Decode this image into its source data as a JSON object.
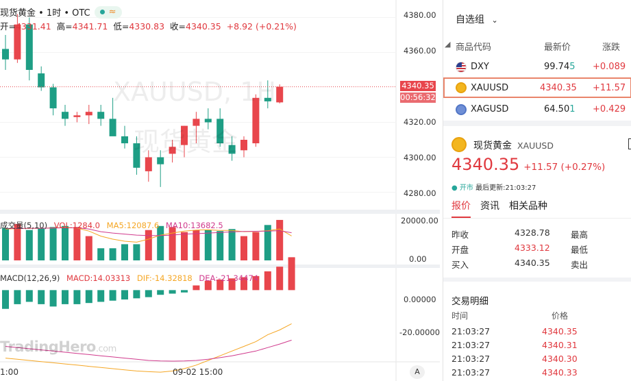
{
  "header": {
    "title": "现货黄金 • 1时 • OTC",
    "status_wave": "≈"
  },
  "ohlc": {
    "open_label": "开=",
    "open": "4331.41",
    "high_label": "高=",
    "high": "4341.71",
    "low_label": "低=",
    "low": "4330.83",
    "close_label": "收=",
    "close": "4340.35",
    "change": "+8.92 (+0.21%)"
  },
  "watermark": {
    "symbol": "XAUUSD, 1H",
    "name": "现货黄金"
  },
  "brand": {
    "name": "TradingHero",
    "suffix": ".com"
  },
  "price_axis": [
    "4380.00",
    "4360.00",
    "4340.35",
    "4320.00",
    "4300.00",
    "4280.00"
  ],
  "current_price_tag": {
    "price": "4340.35",
    "countdown": "00:56:32"
  },
  "volume_legend": {
    "label": "成交量(5,10)",
    "vol": "VOL:1284.0",
    "ma5": "MA5:12087.6",
    "ma10": "MA10:13682.5"
  },
  "volume_axis": [
    "20000.00",
    "0.00"
  ],
  "macd_legend": {
    "label": "MACD(12,26,9)",
    "macd": "MACD:14.03313",
    "dif": "DIF:-14.32818",
    "dea": "DEA:-21.34474"
  },
  "macd_axis": [
    "0.00000",
    "-20.00000"
  ],
  "time_axis": [
    "1:00",
    "09-02 15:00"
  ],
  "auto_button": "A",
  "chart_data": {
    "type": "candlestick",
    "ylim": [
      4270,
      4390
    ],
    "candles": [
      {
        "o": 4362,
        "h": 4370,
        "l": 4350,
        "c": 4356
      },
      {
        "o": 4356,
        "h": 4382,
        "l": 4354,
        "c": 4376
      },
      {
        "o": 4376,
        "h": 4380,
        "l": 4344,
        "c": 4350
      },
      {
        "o": 4348,
        "h": 4352,
        "l": 4338,
        "c": 4340
      },
      {
        "o": 4340,
        "h": 4342,
        "l": 4324,
        "c": 4328
      },
      {
        "o": 4326,
        "h": 4330,
        "l": 4318,
        "c": 4322
      },
      {
        "o": 4323,
        "h": 4326,
        "l": 4320,
        "c": 4324
      },
      {
        "o": 4324,
        "h": 4330,
        "l": 4319,
        "c": 4326
      },
      {
        "o": 4326,
        "h": 4330,
        "l": 4318,
        "c": 4322
      },
      {
        "o": 4322,
        "h": 4334,
        "l": 4316,
        "c": 4312
      },
      {
        "o": 4312,
        "h": 4318,
        "l": 4305,
        "c": 4308
      },
      {
        "o": 4308,
        "h": 4312,
        "l": 4290,
        "c": 4294
      },
      {
        "o": 4292,
        "h": 4304,
        "l": 4286,
        "c": 4300
      },
      {
        "o": 4300,
        "h": 4304,
        "l": 4283,
        "c": 4296
      },
      {
        "o": 4302,
        "h": 4310,
        "l": 4297,
        "c": 4306
      },
      {
        "o": 4307,
        "h": 4318,
        "l": 4300,
        "c": 4318
      },
      {
        "o": 4318,
        "h": 4326,
        "l": 4308,
        "c": 4322
      },
      {
        "o": 4322,
        "h": 4328,
        "l": 4316,
        "c": 4320
      },
      {
        "o": 4322,
        "h": 4328,
        "l": 4306,
        "c": 4308
      },
      {
        "o": 4307,
        "h": 4312,
        "l": 4298,
        "c": 4302
      },
      {
        "o": 4304,
        "h": 4312,
        "l": 4300,
        "c": 4310
      },
      {
        "o": 4308,
        "h": 4336,
        "l": 4306,
        "c": 4334
      },
      {
        "o": 4334,
        "h": 4344,
        "l": 4328,
        "c": 4332
      },
      {
        "o": 4331.41,
        "h": 4341.71,
        "l": 4330.83,
        "c": 4340.35
      }
    ],
    "volume": {
      "ylim": [
        0,
        21000
      ],
      "values": [
        16000,
        18000,
        15000,
        16000,
        16500,
        17000,
        16500,
        12000,
        6000,
        6000,
        8000,
        8000,
        15000,
        17000,
        16500,
        14000,
        15000,
        15000,
        14500,
        15500,
        12000,
        14000,
        17500,
        20000,
        1284
      ],
      "ma5": [
        15500,
        15700,
        15800,
        15900,
        16100,
        16300,
        16000,
        14500,
        12000,
        10500,
        9500,
        9000,
        10500,
        12500,
        13500,
        14500,
        15000,
        15100,
        14800,
        14800,
        14200,
        14300,
        14700,
        15500,
        12087.6
      ],
      "ma10": [
        15800,
        15800,
        15900,
        15900,
        16000,
        16100,
        16100,
        15500,
        14200,
        13500,
        13000,
        12500,
        12300,
        12300,
        12500,
        13000,
        13200,
        13500,
        13800,
        14100,
        14300,
        14400,
        14500,
        14700,
        13682.5
      ]
    },
    "macd": {
      "ylim": [
        -30,
        8
      ],
      "hist": [
        -8,
        -6,
        -5,
        -6,
        -7,
        -6,
        -6,
        -5.5,
        -5,
        -4.5,
        -4,
        -3.5,
        -3,
        -2,
        -1.5,
        -1,
        2,
        4,
        4.5,
        5,
        5.5,
        6,
        8,
        10,
        14.03
      ],
      "dif": [
        -29,
        -29.5,
        -30,
        -30.5,
        -31,
        -31.5,
        -32,
        -32.5,
        -33,
        -33.5,
        -34,
        -34.5,
        -34.8,
        -35,
        -34.5,
        -33.5,
        -32,
        -30,
        -28,
        -26,
        -24,
        -22,
        -19,
        -17,
        -14.33
      ],
      "dea": [
        -24,
        -24.5,
        -25,
        -25.5,
        -26,
        -26.5,
        -27,
        -27.5,
        -28,
        -28.5,
        -29,
        -29.5,
        -30,
        -30.2,
        -30.3,
        -30.2,
        -30,
        -29.5,
        -28.8,
        -28,
        -27,
        -26,
        -24.5,
        -23,
        -21.34
      ]
    }
  },
  "panel": {
    "watchlist_title": "自选组",
    "columns": {
      "symbol": "商品代码",
      "last": "最新价",
      "change": "涨跌"
    },
    "rows": [
      {
        "symbol": "DXY",
        "last_main": "99.74",
        "last_tail": "5",
        "change": "+0.089",
        "flag": "us-flag-icon"
      },
      {
        "symbol": "XAUUSD",
        "last_main": "4340.35",
        "last_tail": "",
        "change": "+11.57",
        "flag": "gold-coin-icon"
      },
      {
        "symbol": "XAGUSD",
        "last_main": "64.50",
        "last_tail": "1",
        "change": "+0.429",
        "flag": "silver-coin-icon"
      }
    ],
    "detail": {
      "name": "现货黄金",
      "code": "XAUUSD",
      "price": "4340.35",
      "change": "+11.57 (+0.27%)",
      "market_state": "开市",
      "updated": "最后更新:21:03:27"
    },
    "tabs": [
      "报价",
      "资讯",
      "相关品种"
    ],
    "stats": {
      "prev_close_label": "昨收",
      "prev_close": "4328.78",
      "open_label": "开盘",
      "open": "4333.12",
      "bid_label": "买入",
      "bid": "4340.35",
      "high_label": "最高",
      "low_label": "最低",
      "ask_label": "卖出"
    },
    "trades": {
      "title": "交易明细",
      "time_header": "时间",
      "price_header": "价格",
      "rows": [
        {
          "time": "21:03:27",
          "price": "4340.35"
        },
        {
          "time": "21:03:27",
          "price": "4340.31"
        },
        {
          "time": "21:03:27",
          "price": "4340.30"
        },
        {
          "time": "21:03:27",
          "price": "4340.33"
        }
      ]
    }
  }
}
